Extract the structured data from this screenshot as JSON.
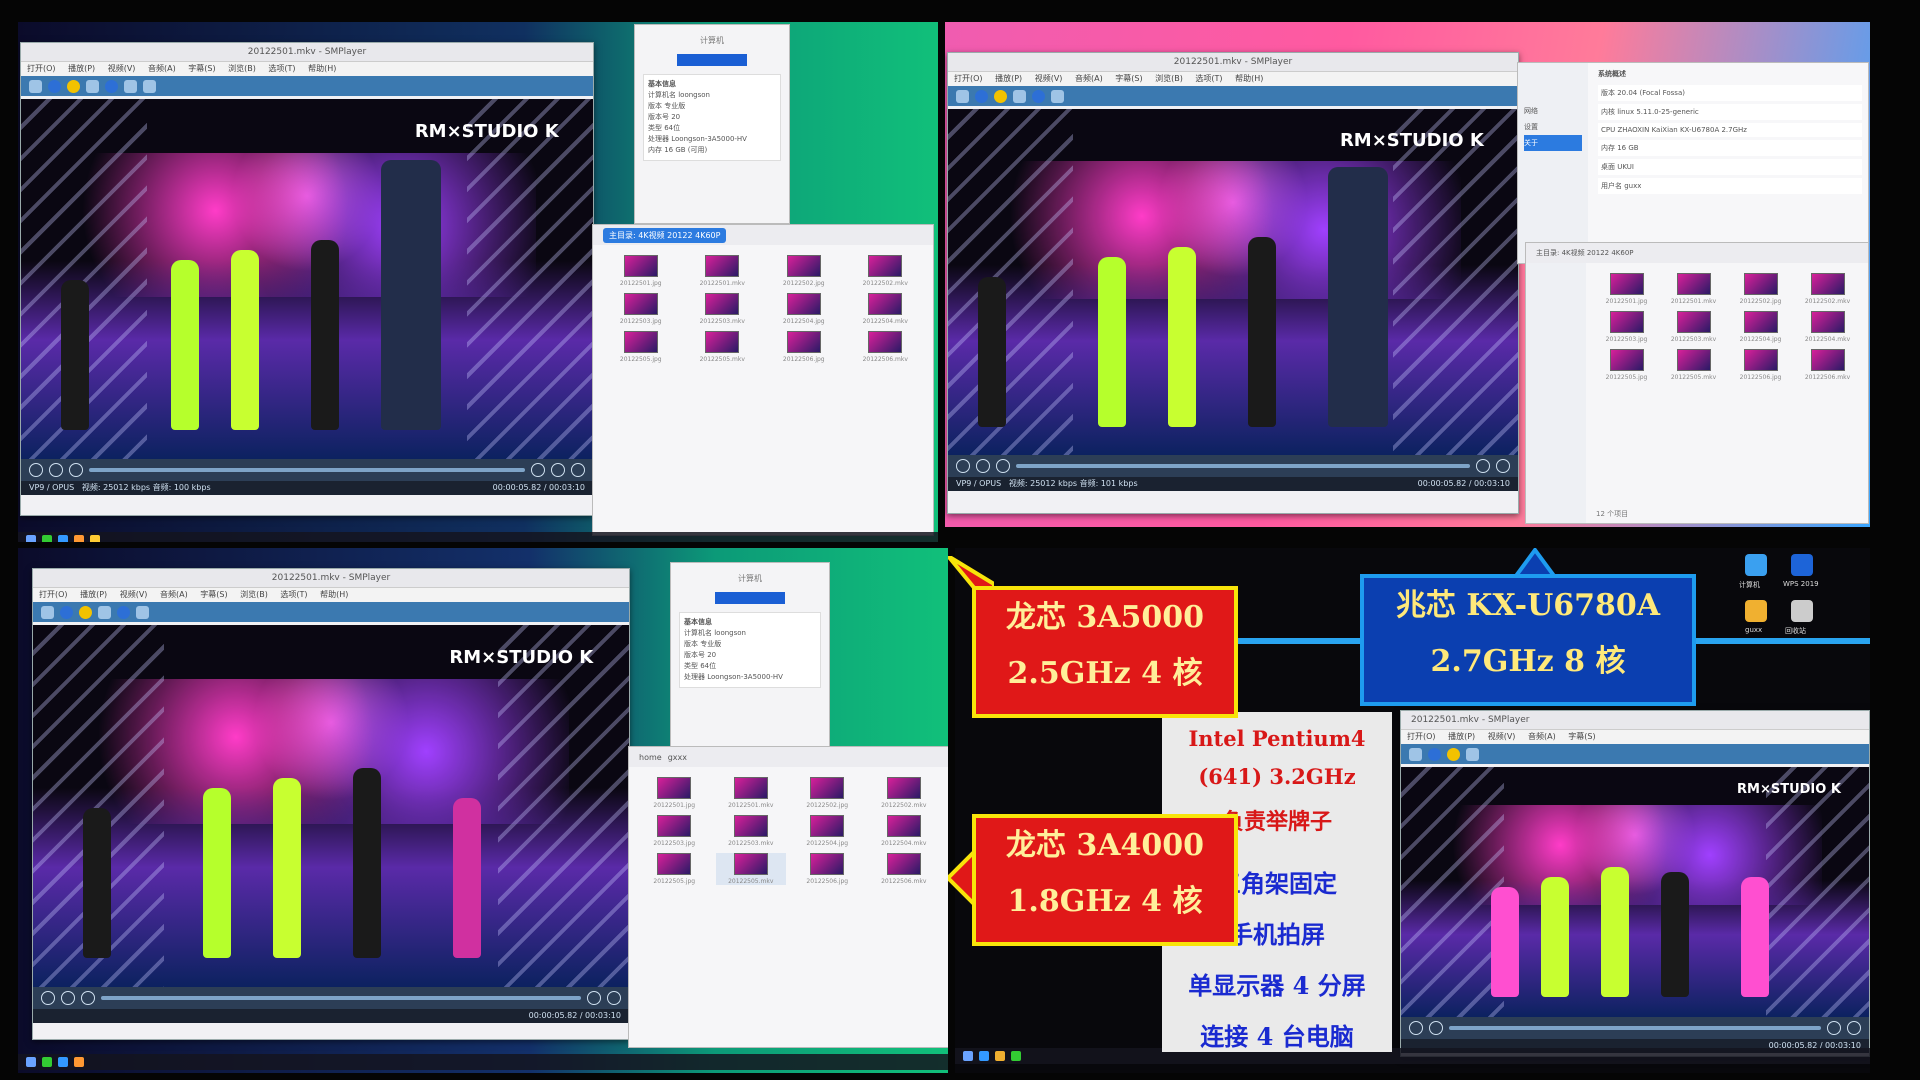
{
  "player": {
    "title_tl": "20122501.mkv - SMPlayer",
    "title_tr": "20122501.mkv - SMPlayer",
    "title_bl": "20122501.mkv - SMPlayer",
    "title_br": "20122501.mkv - SMPlayer",
    "menu": [
      "打开(O)",
      "播放(P)",
      "视频(V)",
      "音频(A)",
      "字幕(S)",
      "浏览(B)",
      "选项(T)",
      "帮助(H)"
    ],
    "codec": "VP9 / OPUS",
    "bitrate_tl": "视频: 25012 kbps  音频: 100 kbps",
    "bitrate_tr": "视频: 25012 kbps  音频: 101 kbps",
    "time": "00:00:05.82 / 00:03:10",
    "watermark": "RM×STUDIO K"
  },
  "file_manager": {
    "path": "主目录: 4K视频 20122 4K60P",
    "tabs_bl": [
      "home",
      "gxxx"
    ],
    "files": [
      "20122501.jpg",
      "20122501.mkv",
      "20122502.jpg",
      "20122502.mkv",
      "20122503.jpg",
      "20122503.mkv",
      "20122504.jpg",
      "20122504.mkv",
      "20122505.jpg",
      "20122505.mkv",
      "20122506.jpg",
      "20122506.mkv"
    ],
    "footer_tr": "12 个项目"
  },
  "computer_info": {
    "title": "计算机",
    "section": "基本信息",
    "rows": [
      "计算机名   loongson",
      "版本   专业版",
      "版本号   20",
      "类型   64位",
      "处理器   Loongson-3A5000-HV",
      "内存   16 GB (可用)"
    ]
  },
  "system_overview": {
    "heading": "系统概述",
    "rows": [
      "版本   20.04 (Focal Fossa)",
      "内核   linux 5.11.0-25-generic",
      "CPU   ZHAOXIN KaiXian KX-U6780A 2.7GHz",
      "内存   16 GB",
      "桌面   UKUI",
      "用户名   guxx"
    ],
    "side": [
      "网络",
      "设置",
      "关于"
    ]
  },
  "desktop_icons": [
    "计算机",
    "WPS 2019",
    "guxx",
    "回收站"
  ],
  "callouts": {
    "c1_line1": "龙芯 3A5000",
    "c1_line2": "2.5GHz  4 核",
    "c2_line1": "兆芯 KX-U6780A",
    "c2_line2": "2.7GHz  8 核",
    "c3_line1": "龙芯 3A4000",
    "c3_line2": "1.8GHz  4 核"
  },
  "notes": {
    "n1": "Intel Pentium4",
    "n2": "(641) 3.2GHz",
    "n3": "负责举牌子",
    "n4": "三角架固定",
    "n5": "手机拍屏",
    "n6": "单显示器 4 分屏",
    "n7": "连接 4 台电脑"
  },
  "colors": {
    "callout_red": "#e01818",
    "callout_blue": "#0b3fb0",
    "callout_border_yellow": "#f8e40a",
    "note_red": "#d81818",
    "note_blue": "#1a2ad0"
  }
}
